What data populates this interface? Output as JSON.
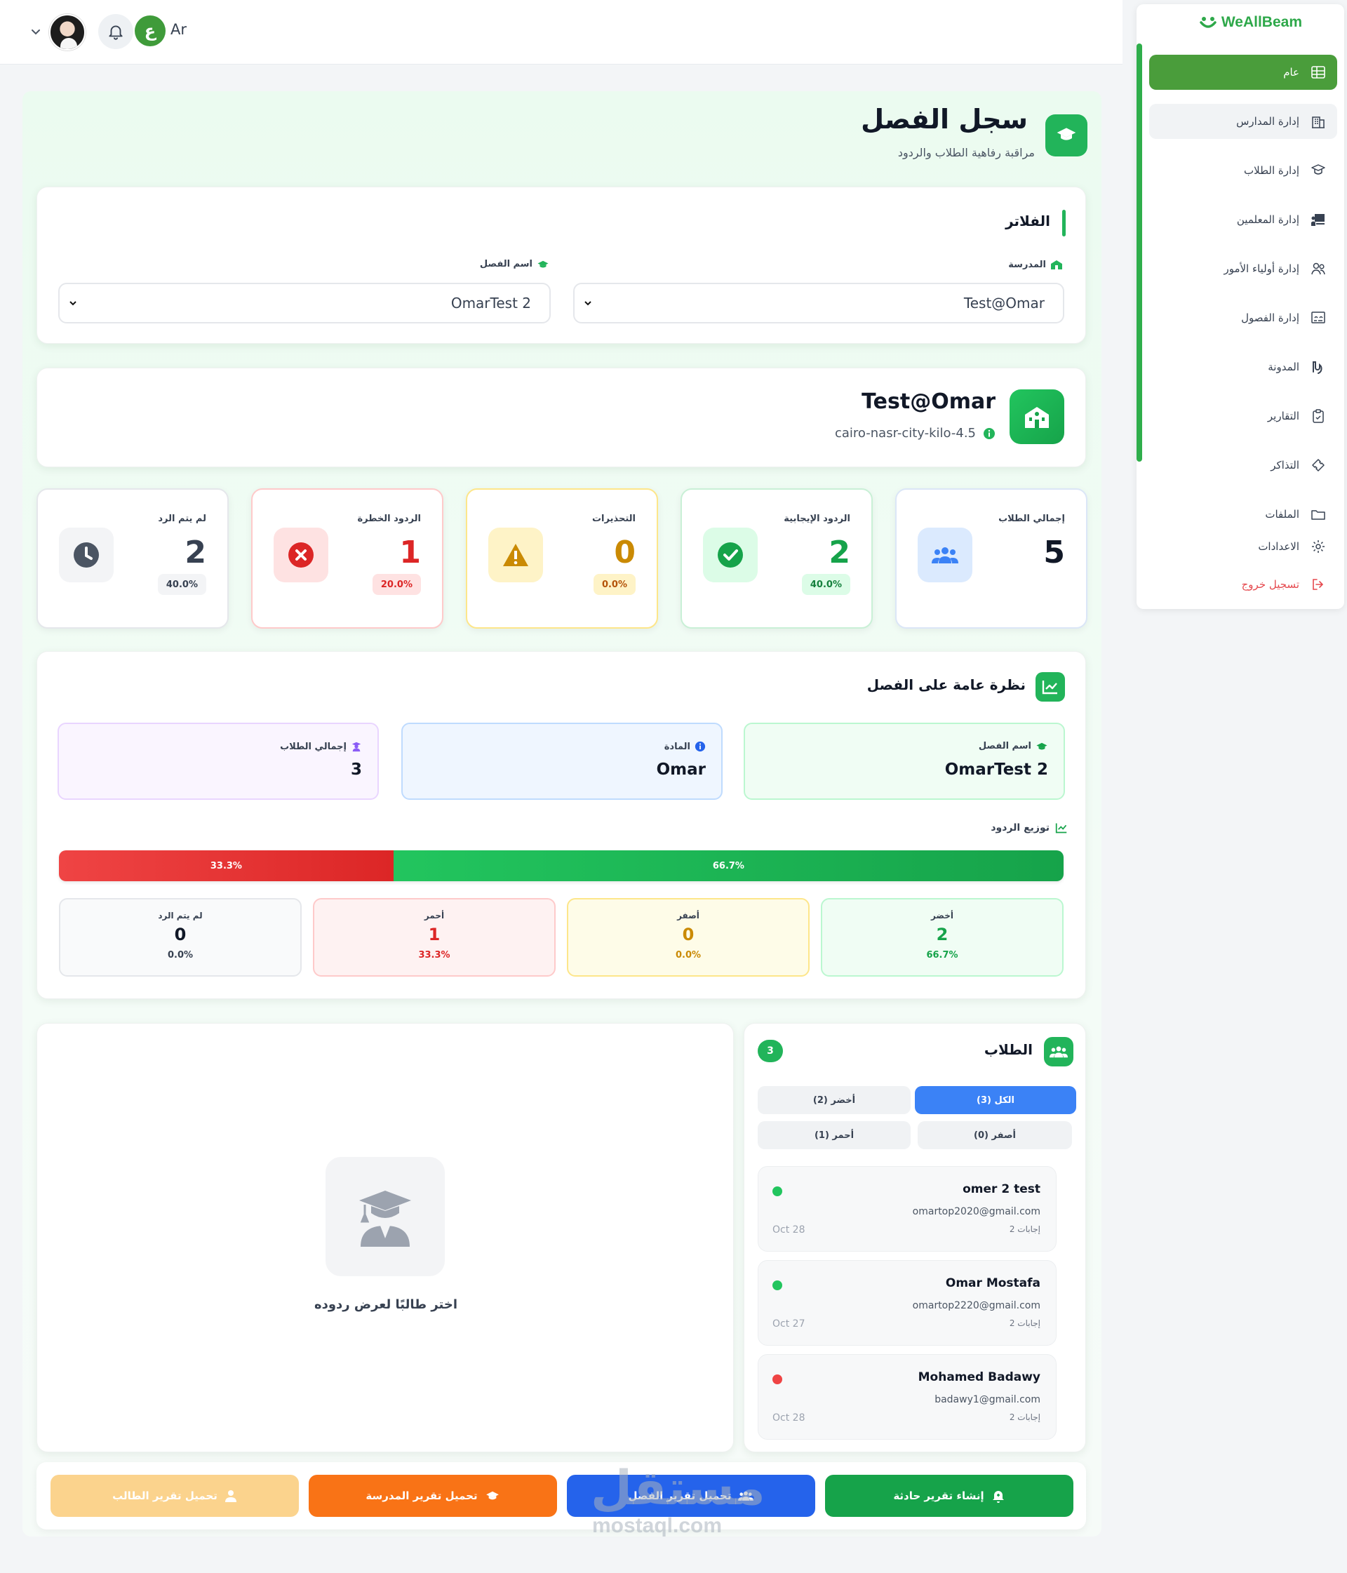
{
  "header": {
    "lang_letter": "ع",
    "lang_label": "Ar"
  },
  "sidebar": {
    "brand": "WeAllBeam",
    "items": [
      {
        "label": "عام",
        "icon": "table-icon"
      },
      {
        "label": "إدارة المدارس",
        "icon": "building-icon"
      },
      {
        "label": "إدارة الطلاب",
        "icon": "student-icon"
      },
      {
        "label": "إدارة المعلمين",
        "icon": "teacher-board-icon"
      },
      {
        "label": "إدارة أولياء الأمور",
        "icon": "users-icon"
      },
      {
        "label": "إدارة الفصول",
        "icon": "classroom-icon"
      },
      {
        "label": "المدونة",
        "icon": "blog-icon"
      },
      {
        "label": "التقارير",
        "icon": "clipboard-icon"
      },
      {
        "label": "التذاكر",
        "icon": "ticket-icon"
      },
      {
        "label": "الملفات",
        "icon": "folder-icon"
      },
      {
        "label": "الاعدادات",
        "icon": "gear-icon"
      },
      {
        "label": "تسجيل خروج",
        "icon": "logout-icon"
      }
    ],
    "brand_color": "#2ea84a"
  },
  "page": {
    "title": "سجل الفصل",
    "subtitle": "مراقبة رفاهية الطلاب والردود"
  },
  "filters": {
    "title": "الفلاتر",
    "school_label": "المدرسة",
    "school_value": "Test@Omar",
    "class_label": "اسم الفصل",
    "class_value": "OmarTest 2"
  },
  "school": {
    "name": "Test@Omar",
    "location": "cairo-nasr-city-kilo-4.5"
  },
  "stats": [
    {
      "title": "إجمالي الطلاب",
      "value": "5",
      "pct": ""
    },
    {
      "title": "الردود الإيجابية",
      "value": "2",
      "pct": "40.0%"
    },
    {
      "title": "التحذيرات",
      "value": "0",
      "pct": "0.0%"
    },
    {
      "title": "الردود الخطرة",
      "value": "1",
      "pct": "20.0%"
    },
    {
      "title": "لم يتم الرد",
      "value": "2",
      "pct": "40.0%"
    }
  ],
  "overview": {
    "title": "نظرة عامة على الفصل",
    "class_label": "اسم الفصل",
    "class_value": "OmarTest 2",
    "subject_label": "المادة",
    "subject_value": "Omar",
    "total_label": "إجمالي الطلاب",
    "total_value": "3",
    "dist_title": "توزيع الردود",
    "bar": {
      "red_label": "33.3%",
      "red_fraction": 0.333,
      "green_label": "66.7%",
      "green_fraction": 0.667
    },
    "dist": [
      {
        "label": "أخضر",
        "value": "2",
        "pct": "66.7%"
      },
      {
        "label": "أصفر",
        "value": "0",
        "pct": "0.0%"
      },
      {
        "label": "أحمر",
        "value": "1",
        "pct": "33.3%"
      },
      {
        "label": "لم يتم الرد",
        "value": "0",
        "pct": "0.0%"
      }
    ]
  },
  "students": {
    "title": "الطلاب",
    "count": "3",
    "tabs": [
      "الكل (3)",
      "أخضر (2)",
      "أصفر (0)",
      "أحمر (1)"
    ],
    "list": [
      {
        "name": "omer 2 test",
        "email": "omartop2020@gmail.com",
        "responses": "2 إجابات",
        "date": "Oct 28",
        "status_color": "#22c55e"
      },
      {
        "name": "Omar Mostafa",
        "email": "omartop2220@gmail.com",
        "responses": "2 إجابات",
        "date": "Oct 27",
        "status_color": "#22c55e"
      },
      {
        "name": "Mohamed Badawy",
        "email": "badawy1@gmail.com",
        "responses": "2 إجابات",
        "date": "Oct 28",
        "status_color": "#ef4444"
      }
    ],
    "empty_text": "اختر طالبًا لعرض ردوده"
  },
  "actions": [
    {
      "label": "إنشاء تقرير حادثة",
      "color": "#16a34a"
    },
    {
      "label": "تحميل تقرير الفصل",
      "color": "#2563eb"
    },
    {
      "label": "تحميل تقرير المدرسة",
      "color": "#f97316"
    },
    {
      "label": "تحميل تقرير الطالب",
      "color": "#fbd38d"
    }
  ],
  "watermark": {
    "arabic": "مستقل",
    "latin": "mostaql.com"
  }
}
